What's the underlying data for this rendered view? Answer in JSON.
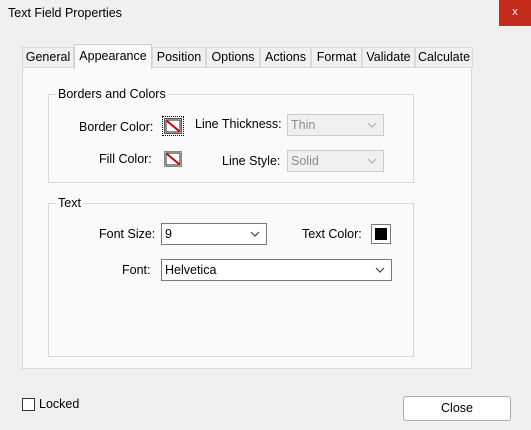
{
  "window": {
    "title": "Text Field Properties",
    "close_glyph": "x"
  },
  "tabs": [
    {
      "label": "General",
      "active": false
    },
    {
      "label": "Appearance",
      "active": true
    },
    {
      "label": "Position",
      "active": false
    },
    {
      "label": "Options",
      "active": false
    },
    {
      "label": "Actions",
      "active": false
    },
    {
      "label": "Format",
      "active": false
    },
    {
      "label": "Validate",
      "active": false
    },
    {
      "label": "Calculate",
      "active": false
    }
  ],
  "borders_group": {
    "title": "Borders and Colors",
    "border_color_label": "Border Color:",
    "border_color_icon": "no-color-swatch",
    "fill_color_label": "Fill Color:",
    "fill_color_icon": "no-color-swatch",
    "line_thickness_label": "Line Thickness:",
    "line_thickness_value": "Thin",
    "line_style_label": "Line Style:",
    "line_style_value": "Solid"
  },
  "text_group": {
    "title": "Text",
    "font_size_label": "Font Size:",
    "font_size_value": "9",
    "text_color_label": "Text Color:",
    "text_color_value": "#000000",
    "font_label": "Font:",
    "font_value": "Helvetica"
  },
  "footer": {
    "locked_label": "Locked",
    "locked_checked": false,
    "close_label": "Close"
  }
}
